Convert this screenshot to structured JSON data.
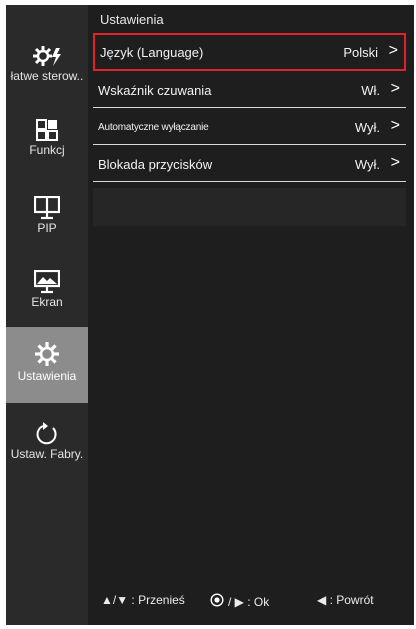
{
  "sidebar": {
    "items": [
      {
        "label": "łatwe sterow..",
        "icon": "easy-control-icon"
      },
      {
        "label": "Funkcj",
        "icon": "function-icon"
      },
      {
        "label": "PIP",
        "icon": "pip-icon"
      },
      {
        "label": "Ekran",
        "icon": "picture-icon"
      },
      {
        "label": "Ustawienia",
        "icon": "settings-icon",
        "selected": true
      },
      {
        "label": "Ustaw. Fabry.",
        "icon": "reset-icon"
      }
    ]
  },
  "panel": {
    "title": "Ustawienia",
    "rows": [
      {
        "label": "Język (Language)",
        "value": "Polski",
        "chevron": ">",
        "selected": true
      },
      {
        "label": "Wskaźnik czuwania",
        "value": "Wł.",
        "chevron": ">"
      },
      {
        "label": "Automatyczne wyłączanie",
        "value": "Wył.",
        "chevron": ">"
      },
      {
        "label": "Blokada przycisków",
        "value": "Wył.",
        "chevron": ">"
      }
    ]
  },
  "footer": {
    "move": "▲/▼ : Przenieś",
    "ok": "/ ▶ : Ok",
    "back": "◀ : Powrót"
  },
  "colors": {
    "sidebar_bg": "#2a2a2a",
    "sidebar_selected": "#8c8c8c",
    "panel_bg": "#1e1e1e",
    "selection_border": "#e32227"
  }
}
